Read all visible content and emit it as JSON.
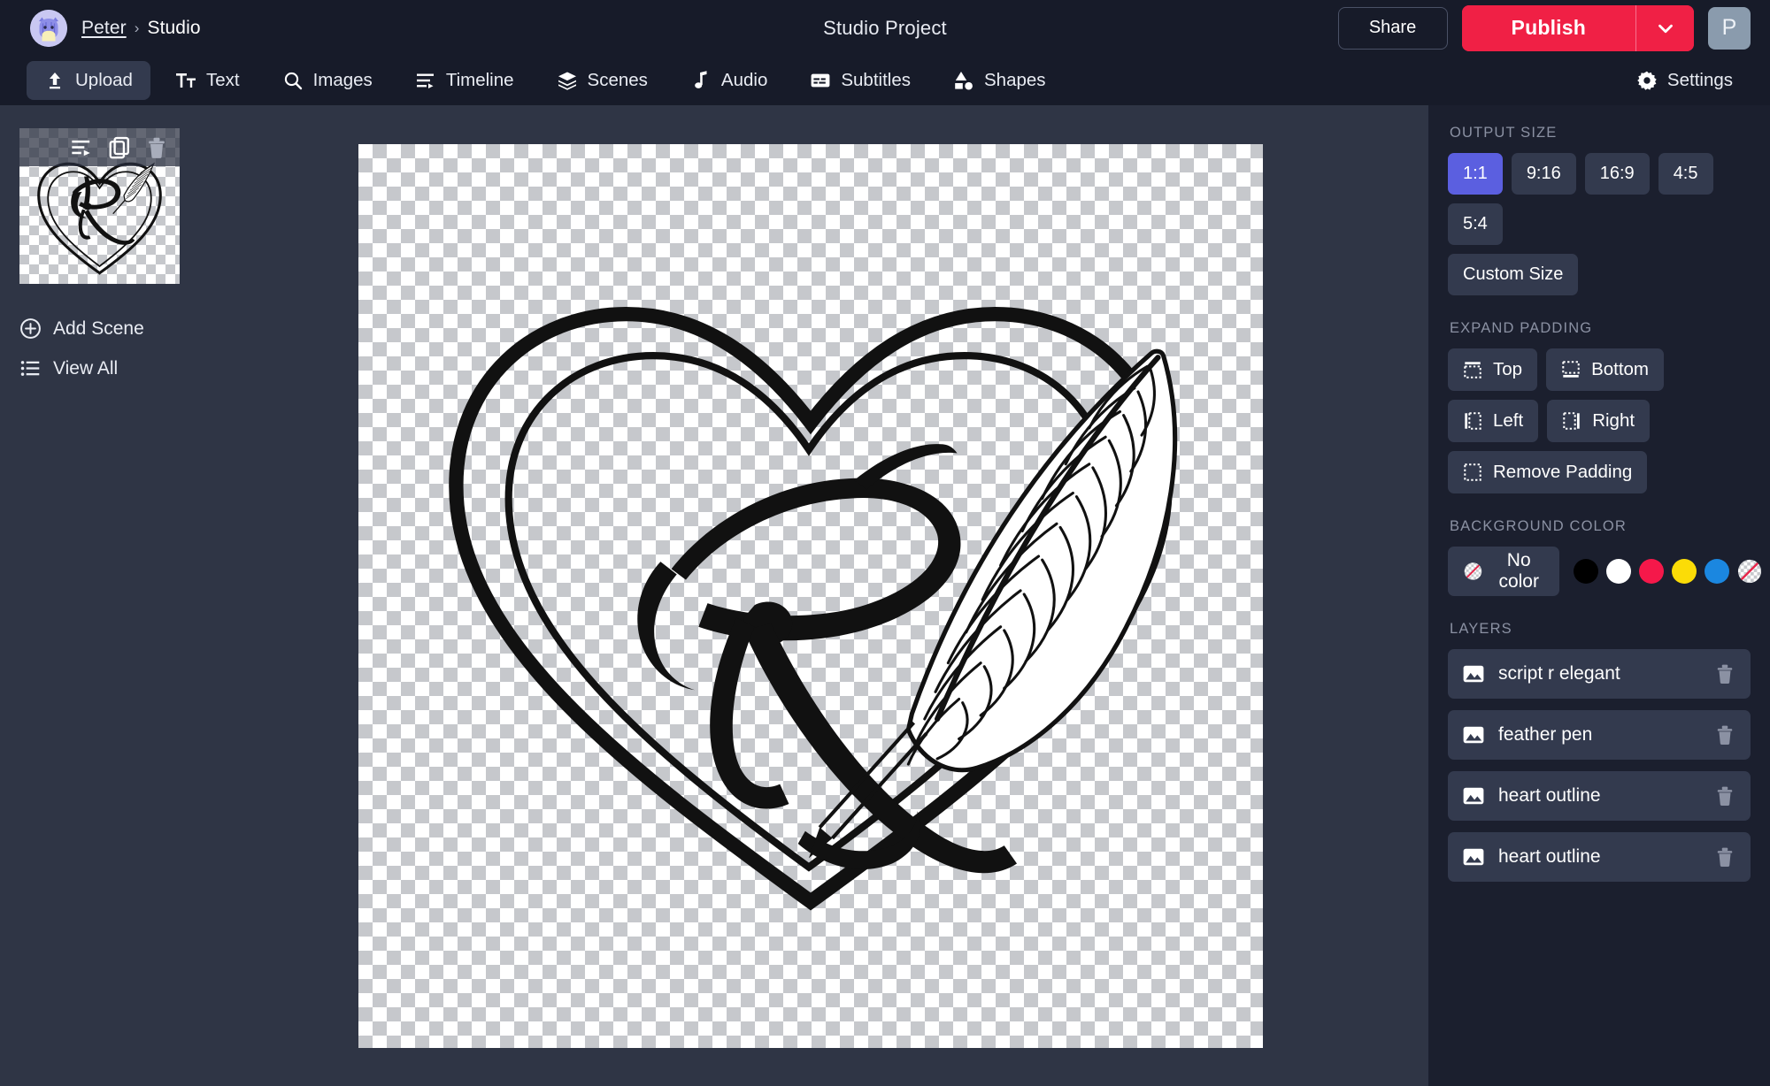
{
  "header": {
    "breadcrumb_user": "Peter",
    "breadcrumb_sep": "›",
    "breadcrumb_current": "Studio",
    "project_title": "Studio Project",
    "share_label": "Share",
    "publish_label": "Publish",
    "user_initial": "P"
  },
  "toolbar": {
    "items": [
      {
        "label": "Upload",
        "icon": "upload-icon",
        "active": true
      },
      {
        "label": "Text",
        "icon": "text-icon",
        "active": false
      },
      {
        "label": "Images",
        "icon": "search-icon",
        "active": false
      },
      {
        "label": "Timeline",
        "icon": "timeline-icon",
        "active": false
      },
      {
        "label": "Scenes",
        "icon": "layers-icon",
        "active": false
      },
      {
        "label": "Audio",
        "icon": "music-note-icon",
        "active": false
      },
      {
        "label": "Subtitles",
        "icon": "subtitles-icon",
        "active": false
      },
      {
        "label": "Shapes",
        "icon": "shapes-icon",
        "active": false
      }
    ],
    "settings_label": "Settings"
  },
  "scenes_rail": {
    "thumb_actions": [
      "reorder-icon",
      "duplicate-icon",
      "delete-icon"
    ],
    "add_scene_label": "Add Scene",
    "view_all_label": "View All"
  },
  "right_panel": {
    "output_size_label": "OUTPUT SIZE",
    "output_sizes": [
      {
        "label": "1:1",
        "active": true
      },
      {
        "label": "9:16",
        "active": false
      },
      {
        "label": "16:9",
        "active": false
      },
      {
        "label": "4:5",
        "active": false
      },
      {
        "label": "5:4",
        "active": false
      }
    ],
    "custom_size_label": "Custom Size",
    "expand_padding_label": "EXPAND PADDING",
    "padding_buttons": [
      {
        "label": "Top",
        "icon": "pad-top-icon"
      },
      {
        "label": "Bottom",
        "icon": "pad-bottom-icon"
      },
      {
        "label": "Left",
        "icon": "pad-left-icon"
      },
      {
        "label": "Right",
        "icon": "pad-right-icon"
      },
      {
        "label": "Remove Padding",
        "icon": "pad-remove-icon"
      }
    ],
    "background_color_label": "BACKGROUND COLOR",
    "no_color_label": "No color",
    "swatches": [
      {
        "name": "black",
        "hex": "#000000"
      },
      {
        "name": "white",
        "hex": "#ffffff"
      },
      {
        "name": "red",
        "hex": "#f5184a"
      },
      {
        "name": "yellow",
        "hex": "#fbdc07"
      },
      {
        "name": "blue",
        "hex": "#1b87e0"
      },
      {
        "name": "transparent",
        "hex": "transparent"
      }
    ],
    "layers_label": "LAYERS",
    "layers": [
      {
        "name": "script r elegant"
      },
      {
        "name": "feather pen"
      },
      {
        "name": "heart outline"
      },
      {
        "name": "heart outline"
      }
    ]
  },
  "colors": {
    "accent_publish": "#f02045",
    "accent_active": "#5b5fe0",
    "topbar_bg": "#171b29",
    "panel_bg": "#1b1f2e",
    "workspace_bg": "#2f3545",
    "chip_bg": "#333a4e"
  }
}
